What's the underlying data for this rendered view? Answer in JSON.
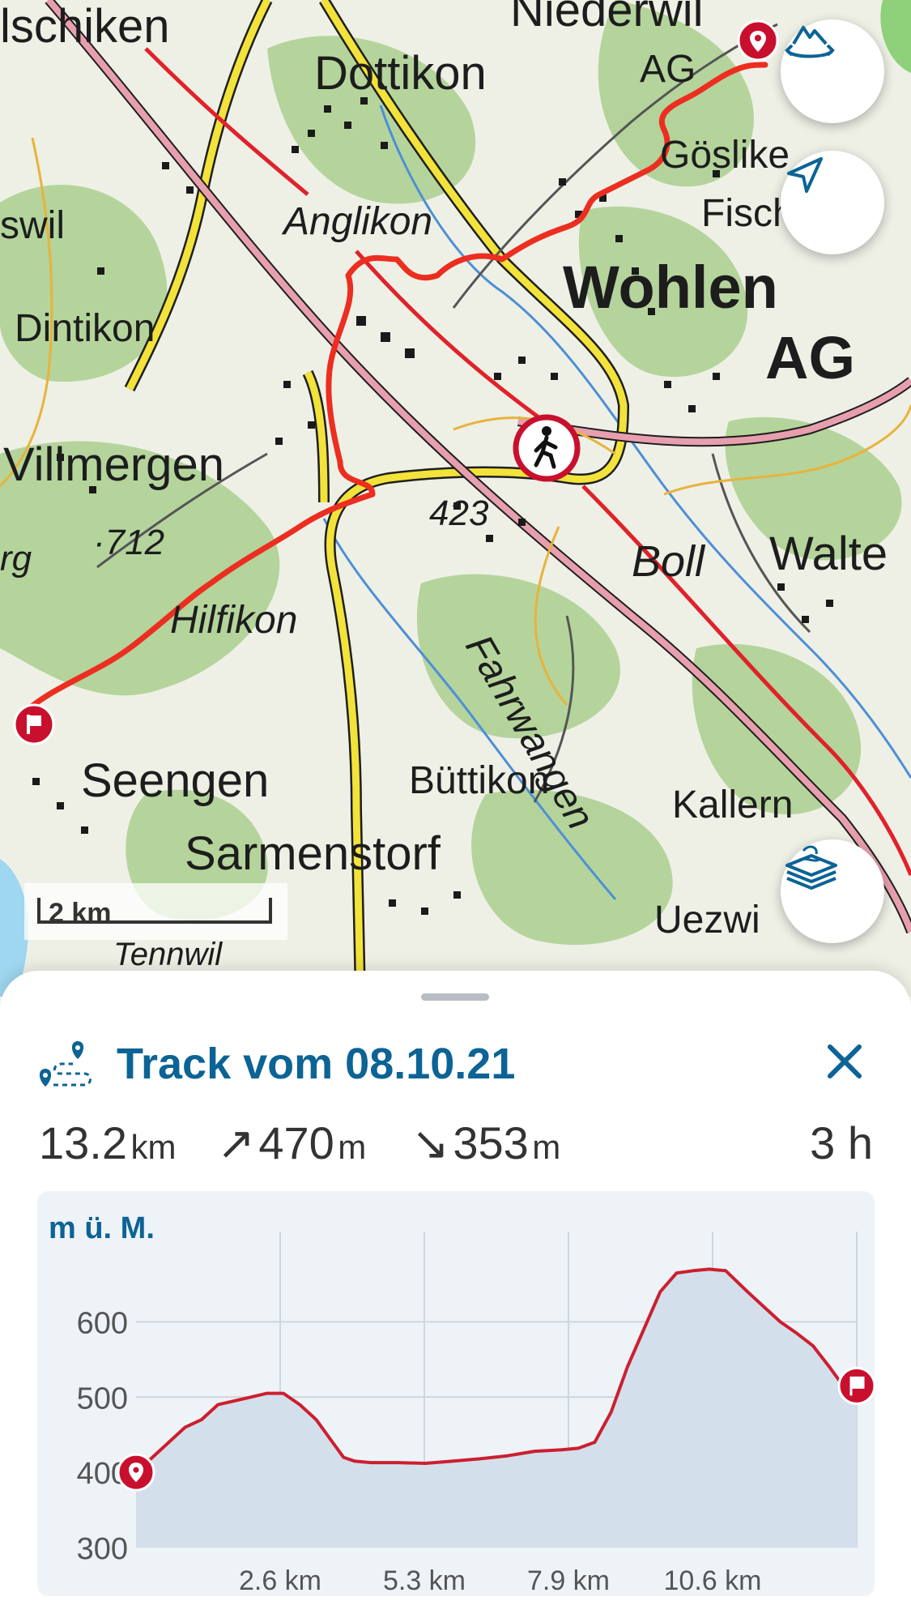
{
  "map": {
    "labels": {
      "schiken": "lschiken",
      "dottikon": "Dottikon",
      "niederwil": "Niederwil",
      "ag_top": "AG",
      "gosliken": "Göslike",
      "fisch": "Fisch",
      "swil": "swil",
      "anglikon": "Anglikon",
      "wohlen": "Wohlen",
      "ag_wohlen": "AG",
      "dintikon": "Dintikon",
      "villmergen": "Villmergen",
      "alt_712": "712",
      "rg": "rg",
      "alt_423": "423",
      "boll": "Boll",
      "walte": "Walte",
      "hilfikon": "Hilfikon",
      "seengen": "Seengen",
      "buttikon": "Büttikon",
      "kallern": "Kallern",
      "sarmenstorf": "Sarmenstorf",
      "uezwil": "Uezwi",
      "fahrwangen": "Fahrwangen",
      "tennwil": "Tennwil"
    },
    "scale_label": "2 km",
    "buttons": {
      "terrain": "terrain-rotate-icon",
      "locate": "location-arrow-icon",
      "layers": "layers-icon"
    },
    "colors": {
      "track": "#e8291f",
      "marker": "#c8102e"
    }
  },
  "sheet": {
    "title": "Track vom 08.10.21",
    "stats": {
      "distance_value": "13.2",
      "distance_unit": "km",
      "ascent_arrow": "↗",
      "ascent_value": "470",
      "ascent_unit": "m",
      "descent_arrow": "↘",
      "descent_value": "353",
      "descent_unit": "m",
      "duration": "3 h"
    }
  },
  "chart_data": {
    "type": "area",
    "title": "",
    "ylabel": "m ü. M.",
    "xlabel": "",
    "ylim": [
      300,
      720
    ],
    "xlim": [
      0,
      13.2
    ],
    "y_ticks": [
      "300",
      "400",
      "500",
      "600"
    ],
    "y_tick_values": [
      300,
      400,
      500,
      600
    ],
    "x_ticks": [
      "2.6 km",
      "5.3 km",
      "7.9 km",
      "10.6 km"
    ],
    "x_tick_values": [
      2.64,
      5.28,
      7.92,
      10.56
    ],
    "series": [
      {
        "x": [
          0,
          0.3,
          0.6,
          0.9,
          1.2,
          1.5,
          1.8,
          2.1,
          2.4,
          2.7,
          3.0,
          3.3,
          3.6,
          3.8,
          4.0,
          4.3,
          4.8,
          5.3,
          5.8,
          6.3,
          6.8,
          7.3,
          7.8,
          8.1,
          8.4,
          8.7,
          9.0,
          9.3,
          9.6,
          9.9,
          10.2,
          10.5,
          10.8,
          11.2,
          11.5,
          11.8,
          12.1,
          12.4,
          12.7,
          13.0,
          13.2
        ],
        "y": [
          400,
          420,
          440,
          460,
          470,
          490,
          495,
          500,
          505,
          505,
          490,
          470,
          440,
          420,
          415,
          413,
          413,
          412,
          415,
          418,
          422,
          428,
          430,
          432,
          440,
          480,
          540,
          590,
          640,
          665,
          668,
          670,
          668,
          640,
          620,
          600,
          585,
          568,
          540,
          510,
          500
        ]
      }
    ],
    "markers": [
      {
        "name": "start",
        "x": 0,
        "y": 400
      },
      {
        "name": "end",
        "x": 13.2,
        "y": 515
      }
    ],
    "grid": true,
    "colors": {
      "line": "#cc1f2f",
      "fill": "#d3e0ec",
      "grid": "#cfd5dc"
    }
  }
}
